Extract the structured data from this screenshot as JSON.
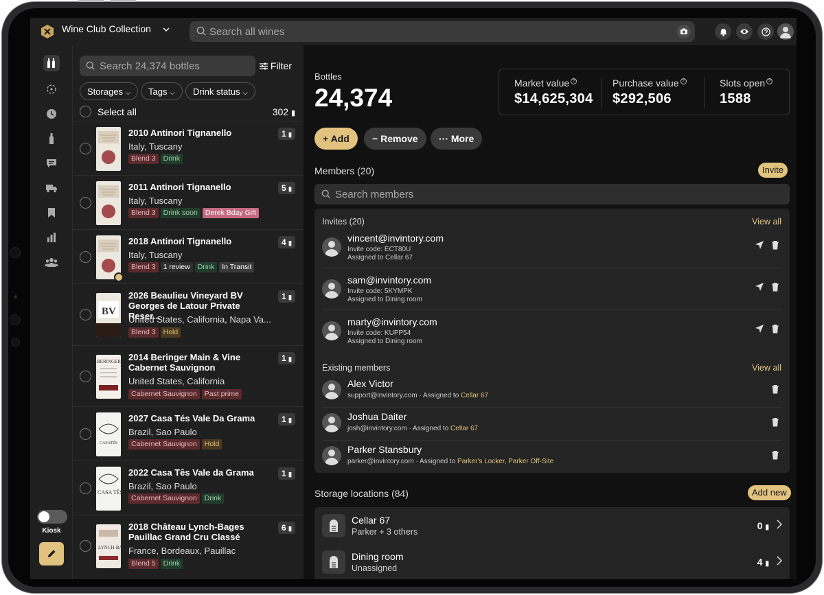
{
  "app": {
    "title": "Wine Club Collection"
  },
  "global_search": {
    "placeholder": "Search all wines"
  },
  "rail": {
    "kiosk_label": "Kiosk"
  },
  "bottle_list": {
    "search_placeholder": "Search 24,374 bottles",
    "filter_label": "Filter",
    "filters": [
      "Storages",
      "Tags",
      "Drink status"
    ],
    "select_all_label": "Select all",
    "select_all_count": "302",
    "items": [
      {
        "name": "2010 Antinori Tignanello",
        "region": "Italy, Tuscany",
        "qty": "1",
        "tags": [
          {
            "text": "Blend 3",
            "kind": "blend"
          },
          {
            "text": "Drink",
            "kind": "drink"
          }
        ]
      },
      {
        "name": "2011 Antinori Tignanello",
        "region": "Italy, Tuscany",
        "qty": "5",
        "tags": [
          {
            "text": "Blend 3",
            "kind": "blend"
          },
          {
            "text": "Drink soon",
            "kind": "soon"
          },
          {
            "text": "Derek Bday Gift",
            "kind": "gift"
          }
        ]
      },
      {
        "name": "2018 Antinori Tignanello",
        "region": "Italy, Tuscany",
        "qty": "4",
        "tags": [
          {
            "text": "Blend 3",
            "kind": "blend"
          },
          {
            "text": "1 review",
            "kind": "rev"
          },
          {
            "text": "Drink",
            "kind": "drink"
          },
          {
            "text": "In Transit",
            "kind": "trans"
          }
        ]
      },
      {
        "name": "2026 Beaulieu Vineyard BV\nGeorges de Latour Private Reser...",
        "region": "United States, California, Napa Va...",
        "qty": "1",
        "tags": [
          {
            "text": "Blend 3",
            "kind": "blend"
          },
          {
            "text": "Hold",
            "kind": "hold"
          }
        ]
      },
      {
        "name": "2014 Beringer Main & Vine\nCabernet Sauvignon",
        "region": "United States, California",
        "qty": "1",
        "tags": [
          {
            "text": "Cabernet Sauvignon",
            "kind": "cab"
          },
          {
            "text": "Past prime",
            "kind": "past"
          }
        ]
      },
      {
        "name": "2027 Casa Tés Vale Da Grama",
        "region": "Brazil, Sao Paulo",
        "qty": "1",
        "tags": [
          {
            "text": "Cabernet Sauvignon",
            "kind": "cab"
          },
          {
            "text": "Hold",
            "kind": "hold"
          }
        ]
      },
      {
        "name": "2022 Casa Tês Vale da Grama",
        "region": "Brazil, Sao Paulo",
        "qty": "1",
        "tags": [
          {
            "text": "Cabernet Sauvignon",
            "kind": "cab"
          },
          {
            "text": "Drink",
            "kind": "drink"
          }
        ]
      },
      {
        "name": "2018 Château Lynch-Bages\nPauillac Grand Cru Classé",
        "region": "France, Bordeaux, Pauillac",
        "qty": "6",
        "tags": [
          {
            "text": "Blend 5",
            "kind": "blend"
          },
          {
            "text": "Drink",
            "kind": "drink"
          }
        ]
      }
    ]
  },
  "summary": {
    "bottles_label": "Bottles",
    "bottles_count": "24,374",
    "market_value_label": "Market value",
    "market_value": "$14,625,304",
    "purchase_value_label": "Purchase value",
    "purchase_value": "$292,506",
    "slots_open_label": "Slots open",
    "slots_open": "1588"
  },
  "actions": {
    "add": "Add",
    "remove": "Remove",
    "more": "More"
  },
  "members": {
    "title": "Members (20)",
    "invite_button": "Invite",
    "search_placeholder": "Search members",
    "invites_title": "Invites (20)",
    "view_all": "View all",
    "invites": [
      {
        "email": "vincent@invintory.com",
        "code": "Invite code: ECT80U",
        "assigned": "Assigned to Cellar 67"
      },
      {
        "email": "sam@invintory.com",
        "code": "Invite code: 5KYMPK",
        "assigned": "Assigned to Dining room"
      },
      {
        "email": "marty@invintory.com",
        "code": "Invite code: KUPP54",
        "assigned": "Assigned to Dining room"
      }
    ],
    "existing_title": "Existing members",
    "existing": [
      {
        "name": "Alex Victor",
        "email": "support@invintory.com",
        "assigned_prefix": " · Assigned to ",
        "location": "Cellar 67"
      },
      {
        "name": "Joshua Daiter",
        "email": "josh@invintory.com",
        "assigned_prefix": " · Assigned to ",
        "location": "Cellar 67"
      },
      {
        "name": "Parker Stansbury",
        "email": "parker@invintory.com",
        "assigned_prefix": " · Assigned to ",
        "location": "Parker's Locker, Parker Off-Site"
      }
    ]
  },
  "storage": {
    "title": "Storage locations (84)",
    "add_new": "Add new",
    "items": [
      {
        "name": "Cellar 67",
        "sub": "Parker + 3 others",
        "count": "0"
      },
      {
        "name": "Dining room",
        "sub": "Unassigned",
        "count": "4"
      }
    ]
  },
  "colors": {
    "accent": "#e1c27e",
    "background": "#111111",
    "panel": "#242424"
  }
}
